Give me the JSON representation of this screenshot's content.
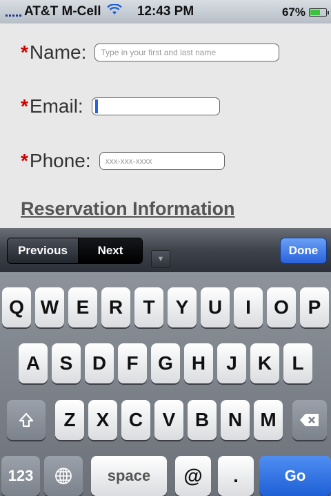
{
  "status_bar": {
    "carrier": "AT&T M-Cell",
    "time": "12:43 PM",
    "battery_percent_text": "67%",
    "battery_level": 0.67
  },
  "form": {
    "name_label": "Name:",
    "name_placeholder": "Type in your first and last name",
    "email_label": "Email:",
    "email_value": "",
    "phone_label": "Phone:",
    "phone_placeholder": "xxx-xxx-xxxx",
    "required_marker": "*",
    "section_heading": "Reservation Information"
  },
  "toolbar": {
    "previous_label": "Previous",
    "next_label": "Next",
    "done_label": "Done"
  },
  "keyboard": {
    "row1": [
      "Q",
      "W",
      "E",
      "R",
      "T",
      "Y",
      "U",
      "I",
      "O",
      "P"
    ],
    "row2": [
      "A",
      "S",
      "D",
      "F",
      "G",
      "H",
      "J",
      "K",
      "L"
    ],
    "row3": [
      "Z",
      "X",
      "C",
      "V",
      "B",
      "N",
      "M"
    ],
    "numbers_label": "123",
    "space_label": "space",
    "at_label": "@",
    "period_label": ".",
    "go_label": "Go"
  },
  "colors": {
    "required": "#cc0000",
    "accent_blue": "#2a62dc"
  }
}
